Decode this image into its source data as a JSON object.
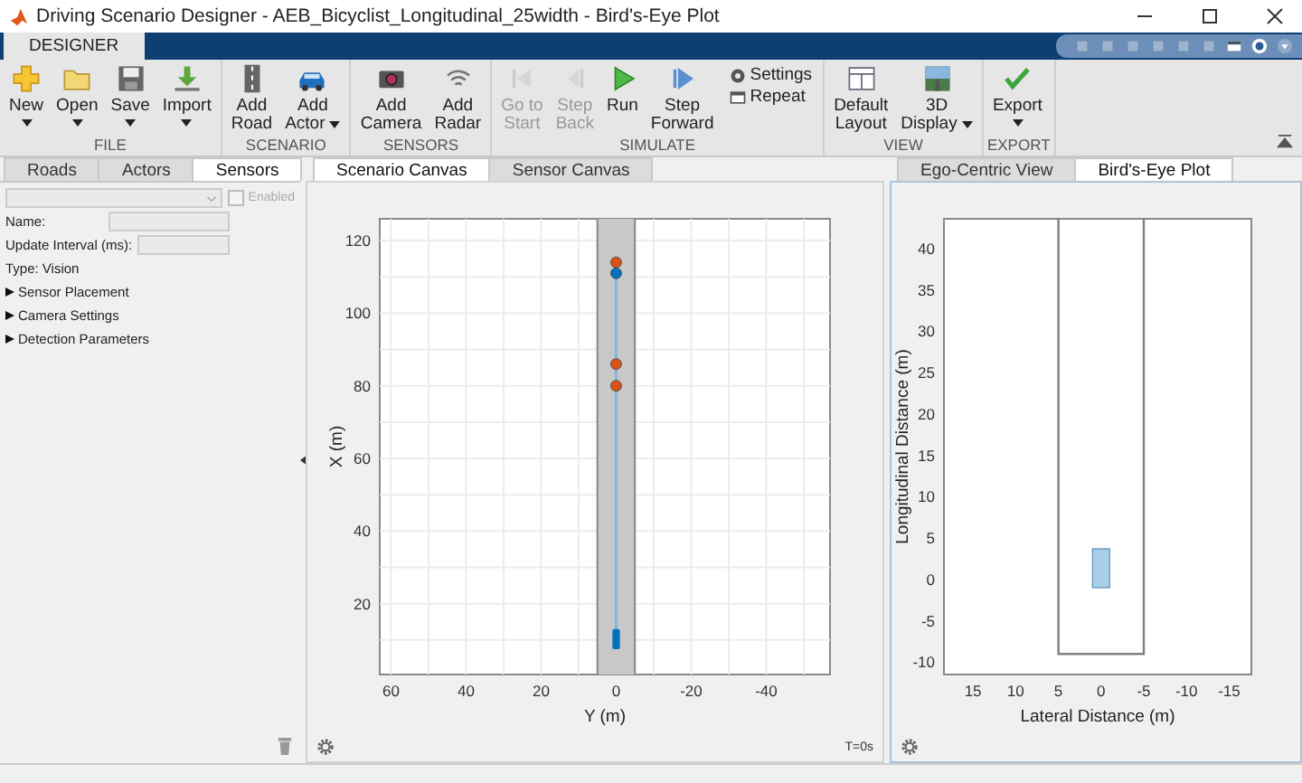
{
  "window": {
    "title": "Driving Scenario Designer - AEB_Bicyclist_Longitudinal_25width - Bird's-Eye Plot"
  },
  "ribbon": {
    "tabs": [
      {
        "label": "DESIGNER",
        "selected": true
      }
    ],
    "groups": [
      {
        "label": "FILE",
        "buttons": [
          {
            "kind": "large",
            "lines": [
              "New"
            ],
            "dropdown": true,
            "disabled": false
          },
          {
            "kind": "large",
            "lines": [
              "Open"
            ],
            "dropdown": true,
            "disabled": false
          },
          {
            "kind": "large",
            "lines": [
              "Save"
            ],
            "dropdown": true,
            "disabled": false
          },
          {
            "kind": "large",
            "lines": [
              "Import"
            ],
            "dropdown": true,
            "disabled": false
          }
        ]
      },
      {
        "label": "SCENARIO",
        "buttons": [
          {
            "kind": "large",
            "lines": [
              "Add",
              "Road"
            ],
            "dropdown": false,
            "disabled": false
          },
          {
            "kind": "large",
            "lines": [
              "Add",
              "Actor"
            ],
            "dropdown": true,
            "disabled": false
          }
        ]
      },
      {
        "label": "SENSORS",
        "buttons": [
          {
            "kind": "large",
            "lines": [
              "Add",
              "Camera"
            ],
            "dropdown": false,
            "disabled": false
          },
          {
            "kind": "large",
            "lines": [
              "Add",
              "Radar"
            ],
            "dropdown": false,
            "disabled": false
          }
        ]
      },
      {
        "label": "SIMULATE",
        "buttons": [
          {
            "kind": "large",
            "lines": [
              "Go to",
              "Start"
            ],
            "dropdown": false,
            "disabled": true
          },
          {
            "kind": "large",
            "lines": [
              "Step",
              "Back"
            ],
            "dropdown": false,
            "disabled": true
          },
          {
            "kind": "large",
            "lines": [
              "Run"
            ],
            "dropdown": false,
            "disabled": false
          },
          {
            "kind": "large",
            "lines": [
              "Step",
              "Forward"
            ],
            "dropdown": false,
            "disabled": false
          },
          {
            "kind": "small",
            "lines": [
              "Settings"
            ],
            "disabled": false
          },
          {
            "kind": "toggle",
            "lines": [
              "Repeat"
            ],
            "disabled": false,
            "checked": false
          }
        ]
      },
      {
        "label": "VIEW",
        "buttons": [
          {
            "kind": "large",
            "lines": [
              "Default",
              "Layout"
            ],
            "dropdown": false,
            "disabled": false
          },
          {
            "kind": "large",
            "lines": [
              "3D",
              "Display"
            ],
            "dropdown": true,
            "disabled": false
          }
        ]
      },
      {
        "label": "EXPORT",
        "buttons": [
          {
            "kind": "large",
            "lines": [
              "Export"
            ],
            "dropdown": true,
            "disabled": false
          }
        ]
      }
    ]
  },
  "left_panel": {
    "tabs": [
      {
        "label": "Roads",
        "selected": false
      },
      {
        "label": "Actors",
        "selected": false
      },
      {
        "label": "Sensors",
        "selected": true
      }
    ],
    "enabled": {
      "label": "Enabled",
      "checked": false,
      "disabled": true
    },
    "fields": [
      {
        "label": "Name:"
      },
      {
        "label": "Update Interval (ms):"
      }
    ],
    "type_text": "Type: Vision",
    "sections": [
      {
        "label": "Sensor Placement",
        "expanded": false
      },
      {
        "label": "Camera Settings",
        "expanded": false
      },
      {
        "label": "Detection Parameters",
        "expanded": false
      }
    ]
  },
  "scenario_canvas": {
    "tabs": [
      {
        "label": "Scenario Canvas",
        "selected": true
      },
      {
        "label": "Sensor Canvas",
        "selected": false
      }
    ],
    "plot": {
      "xlabel": "Y (m)",
      "ylabel": "X (m)",
      "xticks": [
        "60",
        "40",
        "20",
        "0",
        "-20",
        "-40"
      ],
      "yticks": [
        "120",
        "100",
        "80",
        "60",
        "40",
        "20"
      ]
    },
    "time": "T=0s"
  },
  "birds_eye": {
    "tabs": [
      {
        "label": "Ego-Centric View",
        "selected": false
      },
      {
        "label": "Bird's-Eye Plot",
        "selected": true
      }
    ],
    "plot": {
      "xlabel": "Lateral Distance (m)",
      "ylabel": "Longitudinal Distance (m)",
      "xticks": [
        "15",
        "10",
        "5",
        "0",
        "-5",
        "-10",
        "-15"
      ],
      "yticks": [
        "40",
        "35",
        "30",
        "25",
        "20",
        "15",
        "10",
        "5",
        "0",
        "-5",
        "-10"
      ]
    }
  }
}
